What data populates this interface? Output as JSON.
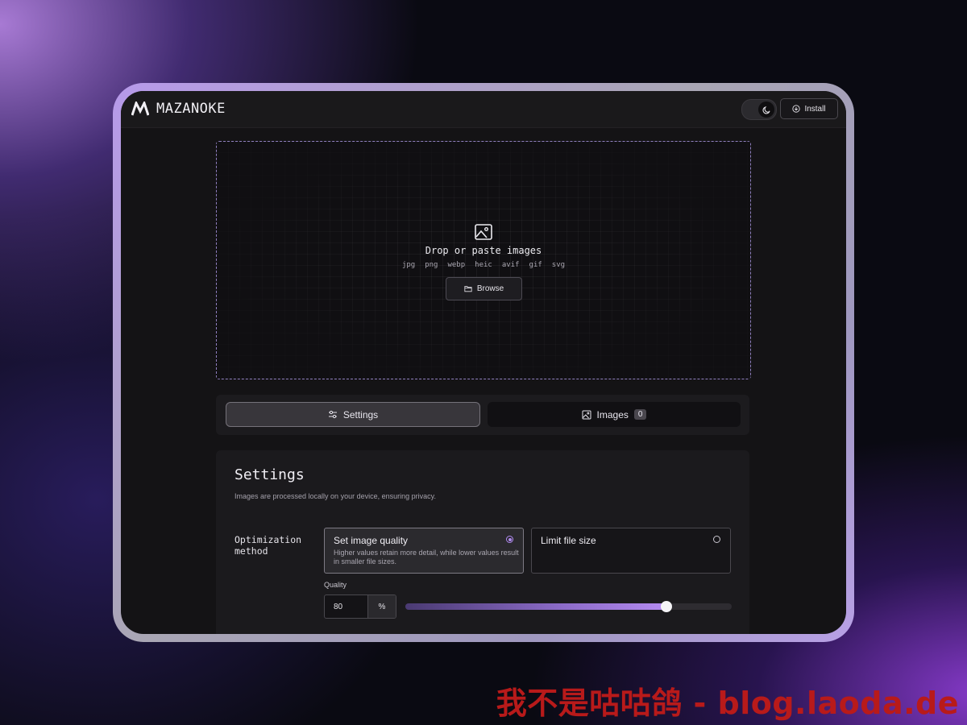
{
  "app": {
    "name": "MAZANOKE"
  },
  "topbar": {
    "install_label": "Install",
    "theme_icon": "moon-icon"
  },
  "dropzone": {
    "title": "Drop or paste images",
    "formats": [
      "jpg",
      "png",
      "webp",
      "heic",
      "avif",
      "gif",
      "svg"
    ],
    "browse_label": "Browse"
  },
  "tabs": [
    {
      "label": "Settings",
      "icon": "sliders-icon",
      "active": true
    },
    {
      "label": "Images",
      "icon": "image-icon",
      "count": "0",
      "active": false
    }
  ],
  "settings": {
    "title": "Settings",
    "subtitle": "Images are processed locally on your device, ensuring privacy.",
    "optimization_label": "Optimization method",
    "options": [
      {
        "title": "Set image quality",
        "description": "Higher values retain more detail, while lower values result in smaller file sizes.",
        "selected": true
      },
      {
        "title": "Limit file size",
        "description": "",
        "selected": false
      }
    ],
    "quality": {
      "label": "Quality",
      "value": "80",
      "unit": "%",
      "slider_fraction": 0.8
    }
  },
  "colors": {
    "accent": "#b08af0",
    "background": "#141315"
  },
  "watermark": "我不是咕咕鸽 - blog.laoda.de"
}
